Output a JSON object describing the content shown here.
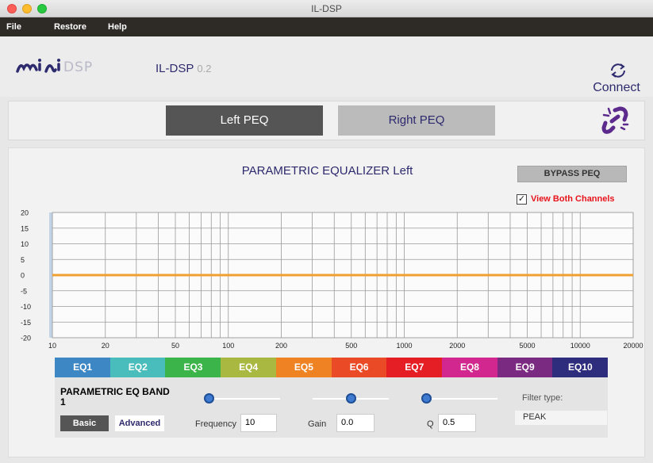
{
  "window": {
    "title": "IL-DSP"
  },
  "menu": [
    "File",
    "Restore",
    "Help"
  ],
  "header": {
    "app_name": "IL-DSP",
    "version": "0.2",
    "connect_label": "Connect"
  },
  "tabs": {
    "left": "Left PEQ",
    "right": "Right PEQ"
  },
  "panel": {
    "title": "PARAMETRIC EQUALIZER Left",
    "bypass_label": "BYPASS PEQ",
    "view_both_label": "View Both Channels",
    "view_both_checked": true
  },
  "chart_data": {
    "type": "line",
    "y_ticks": [
      "20",
      "15",
      "10",
      "5",
      "0",
      "-5",
      "-10",
      "-15",
      "-20"
    ],
    "x_ticks": [
      "10",
      "20",
      "50",
      "100",
      "200",
      "500",
      "1000",
      "2000",
      "5000",
      "10000",
      "20000"
    ],
    "ylim": [
      -20,
      20
    ],
    "xlim": [
      10,
      20000
    ],
    "x_scale": "log",
    "grid": true,
    "series": [
      {
        "color": "#f0a030",
        "x": [
          10,
          20000
        ],
        "y": [
          0,
          0
        ]
      }
    ]
  },
  "eq_tabs": [
    {
      "label": "EQ1",
      "color": "#3e87c5"
    },
    {
      "label": "EQ2",
      "color": "#49bcbc"
    },
    {
      "label": "EQ3",
      "color": "#3bb54a"
    },
    {
      "label": "EQ4",
      "color": "#a9b841"
    },
    {
      "label": "EQ5",
      "color": "#ef8222"
    },
    {
      "label": "EQ6",
      "color": "#ea4b26"
    },
    {
      "label": "EQ7",
      "color": "#e51d25"
    },
    {
      "label": "EQ8",
      "color": "#d1278f"
    },
    {
      "label": "EQ9",
      "color": "#7b2a82"
    },
    {
      "label": "EQ10",
      "color": "#2e2c7d"
    }
  ],
  "band": {
    "title": "PARAMETRIC EQ BAND 1",
    "basic_label": "Basic",
    "advanced_label": "Advanced",
    "frequency_label": "Frequency",
    "frequency_value": "10",
    "gain_label": "Gain",
    "gain_value": "0.0",
    "q_label": "Q",
    "q_value": "0.5",
    "filter_type_label": "Filter type:",
    "filter_type_value": "PEAK",
    "frequency_slider": 0.0,
    "gain_slider": 0.5,
    "q_slider": 0.0
  },
  "colors": {
    "accent": "#2d2a6d",
    "curve": "#f0a030",
    "view_both": "#e8141c"
  }
}
